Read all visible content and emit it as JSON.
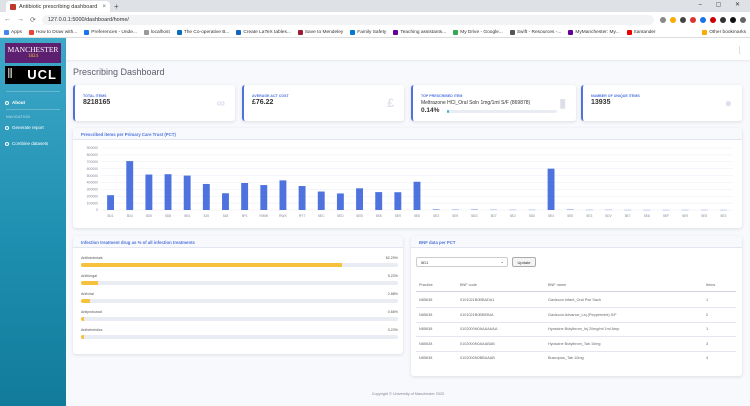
{
  "browser": {
    "tab_title": "Antibiotic prescribing dashboard",
    "url": "127.0.0.1:5000/dashboard/home/",
    "bookmarks": [
      {
        "label": "Apps",
        "color": "#4285f4"
      },
      {
        "label": "How to Draw with...",
        "color": "#ea4335"
      },
      {
        "label": "Preferences - Unde...",
        "color": "#1a73e8"
      },
      {
        "label": "localhost",
        "color": "#999999"
      },
      {
        "label": "The Co-operative B...",
        "color": "#0a6ebd"
      },
      {
        "label": "Create LaTeX tables...",
        "color": "#1565c0"
      },
      {
        "label": "Save to Mendeley",
        "color": "#9e1b32"
      },
      {
        "label": "Family Safety",
        "color": "#0078d4"
      },
      {
        "label": "Teaching assistants...",
        "color": "#660099"
      },
      {
        "label": "My Drive - Google...",
        "color": "#34a853"
      },
      {
        "label": "Swift - Resources -...",
        "color": "#555555"
      },
      {
        "label": "MyManchester: My...",
        "color": "#660099"
      },
      {
        "label": "Santander",
        "color": "#ec0000"
      },
      {
        "label": "Other bookmarks",
        "color": "#f9ab00"
      }
    ]
  },
  "sidebar": {
    "logo_top": "MANCHESTER",
    "logo_year": "1824",
    "logo_bottom": "UCL",
    "items": [
      {
        "label": "About"
      },
      {
        "section": "Navigation"
      },
      {
        "label": "Generate report"
      },
      {
        "label": "Combine datasets"
      }
    ]
  },
  "page": {
    "title": "Prescribing Dashboard"
  },
  "stats": [
    {
      "label": "Total items",
      "value": "8218165",
      "icon": "pills-icon"
    },
    {
      "label": "Average act cost",
      "value": "£76.22",
      "icon": "pound-icon"
    },
    {
      "label": "Top prescribed item",
      "value": "Meltrazone HCl_Oral Soln 1mg/1ml S/F (869878)",
      "percent": "0.14%",
      "progress": 0.14,
      "icon": "clipboard-icon"
    },
    {
      "label": "Number of unique items",
      "value": "13935",
      "icon": "chart-pie-icon"
    }
  ],
  "pct_card": {
    "title": "Prescribed items per Primary Care Trust (PCT)"
  },
  "chart_data": {
    "type": "bar",
    "title": "Prescribed items per Primary Care Trust (PCT)",
    "color": "#4e73df",
    "ylim": [
      0,
      900000
    ],
    "yticks": [
      "900000",
      "800000",
      "700000",
      "600000",
      "500000",
      "400000",
      "300000",
      "200000",
      "100000",
      "0"
    ],
    "categories": [
      "5D1",
      "5D4",
      "5D5",
      "5D8",
      "5E4",
      "5J5",
      "5J8",
      "5P1",
      "RWW",
      "RWX",
      "RYT",
      "5EC",
      "5ED",
      "5EB",
      "5E8",
      "5E9",
      "5E8",
      "5E3",
      "5E9",
      "5DG",
      "5D7",
      "5E2",
      "5D0",
      "5E4",
      "5E5",
      "5E3",
      "5DV",
      "5E7",
      "5E8",
      "5EF",
      "5E9",
      "5E5",
      "5E3"
    ],
    "values": [
      215000,
      710000,
      515000,
      520000,
      500000,
      378000,
      243000,
      392000,
      362000,
      430000,
      348000,
      268000,
      240000,
      315000,
      260000,
      258000,
      410000,
      8000,
      5000,
      6000,
      4000,
      3000,
      3000,
      600000,
      6000,
      3000,
      3000,
      2000,
      2000,
      2000,
      2000,
      2000,
      2000
    ]
  },
  "infection": {
    "title": "Infection treatment drug as % of all infection treatments",
    "rows": [
      {
        "label": "Antibacterials",
        "percent": "82.29%",
        "value": 82.29
      },
      {
        "label": "Antifungal",
        "percent": "5.23%",
        "value": 5.23
      },
      {
        "label": "Antiviral",
        "percent": "2.88%",
        "value": 2.88
      },
      {
        "label": "Antiprotozoal",
        "percent": "0.66%",
        "value": 0.66
      },
      {
        "label": "Anthelmintics",
        "percent": "0.23%",
        "value": 0.23
      }
    ]
  },
  "bnf": {
    "title": "BNF data per PCT",
    "select_value": "5D1",
    "update_label": "Update",
    "columns": [
      "Practice",
      "BNF code",
      "BNF name",
      "Items"
    ],
    "rows": [
      [
        "N85638",
        "0101021B0BBADA1",
        "Gaviscon Infant_Oral Pwr Sach",
        "1"
      ],
      [
        "N85638",
        "0101021B0BBEBAL",
        "Gaviscon Advance_Liq (Peppermint) S/F",
        "2"
      ],
      [
        "N85638",
        "0102000N0AAAAAAA",
        "Hyoscine Butylbrom_Inj 20mg/ml 1ml Amp",
        "1"
      ],
      [
        "N85638",
        "0102000N0AAABAB",
        "Hyoscine Butylbrom_Tab 10mg",
        "3"
      ],
      [
        "N85638",
        "0102000N0BBAAAB",
        "Buscopan_Tab 10mg",
        "4"
      ]
    ]
  },
  "footer": "Copyright © University of Manchester 2020"
}
